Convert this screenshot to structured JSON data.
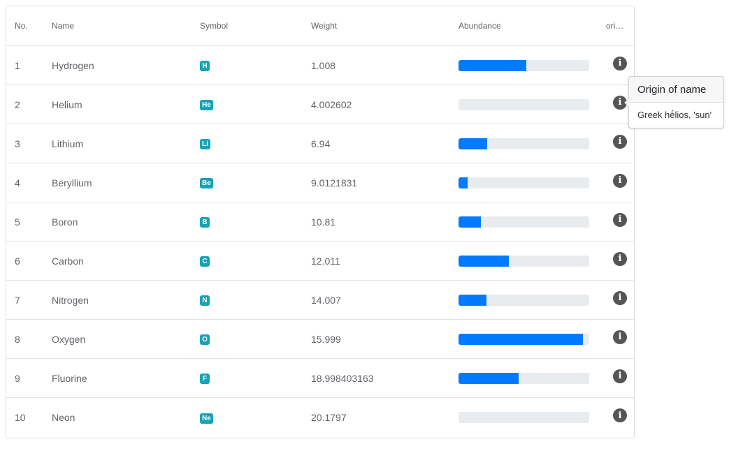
{
  "table": {
    "headers": {
      "no": "No.",
      "name": "Name",
      "symbol": "Symbol",
      "weight": "Weight",
      "abundance": "Abundance",
      "origin": "ori…"
    },
    "rows": [
      {
        "no": "1",
        "name": "Hydrogen",
        "symbol": "H",
        "weight": "1.008",
        "abundance": 0.52
      },
      {
        "no": "2",
        "name": "Helium",
        "symbol": "He",
        "weight": "4.002602",
        "abundance": 0.0
      },
      {
        "no": "3",
        "name": "Lithium",
        "symbol": "Li",
        "weight": "6.94",
        "abundance": 0.22
      },
      {
        "no": "4",
        "name": "Beryllium",
        "symbol": "Be",
        "weight": "9.0121831",
        "abundance": 0.07
      },
      {
        "no": "5",
        "name": "Boron",
        "symbol": "B",
        "weight": "10.81",
        "abundance": 0.17
      },
      {
        "no": "6",
        "name": "Carbon",
        "symbol": "C",
        "weight": "12.011",
        "abundance": 0.385
      },
      {
        "no": "7",
        "name": "Nitrogen",
        "symbol": "N",
        "weight": "14.007",
        "abundance": 0.215
      },
      {
        "no": "8",
        "name": "Oxygen",
        "symbol": "O",
        "weight": "15.999",
        "abundance": 0.95
      },
      {
        "no": "9",
        "name": "Fluorine",
        "symbol": "F",
        "weight": "18.998403163",
        "abundance": 0.46
      },
      {
        "no": "10",
        "name": "Neon",
        "symbol": "Ne",
        "weight": "20.1797",
        "abundance": 0.0
      }
    ],
    "info_icon": "info-circle-icon"
  },
  "popover": {
    "title": "Origin of name",
    "body": "Greek hḗlios, 'sun'"
  },
  "colors": {
    "badge": "#17a2b8",
    "bar_fill": "#007bff",
    "bar_track": "#e9ecef",
    "info_icon": "#555555"
  }
}
